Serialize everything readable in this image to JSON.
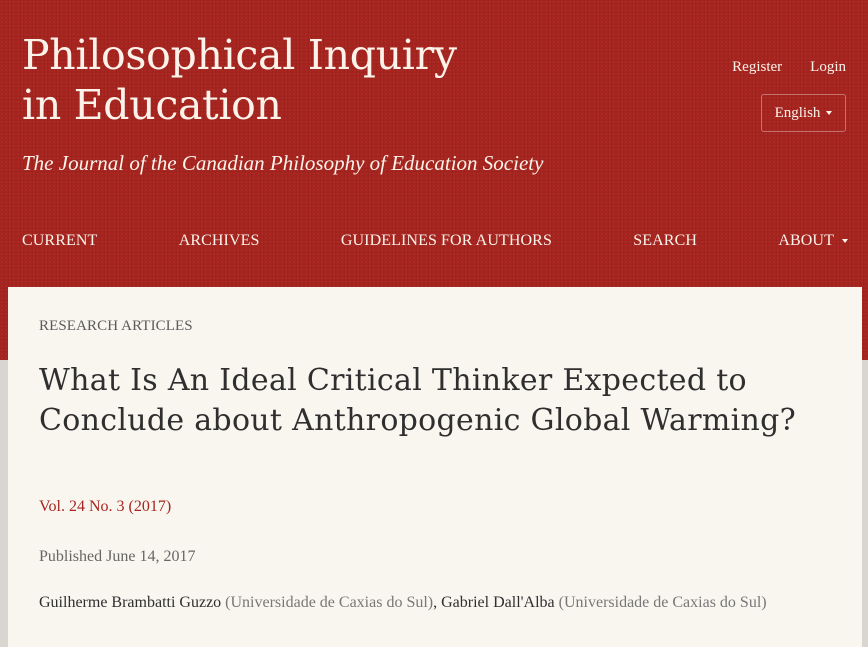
{
  "header": {
    "title_line1": "Philosophical Inquiry",
    "title_line2": "in Education",
    "tagline": "The Journal of the Canadian Philosophy of Education Society",
    "user_nav": {
      "register": "Register",
      "login": "Login"
    },
    "language": "English"
  },
  "nav": {
    "items": [
      {
        "label": "CURRENT"
      },
      {
        "label": "ARCHIVES"
      },
      {
        "label": "GUIDELINES FOR AUTHORS"
      },
      {
        "label": "SEARCH"
      },
      {
        "label": "ABOUT"
      }
    ]
  },
  "article": {
    "section": "RESEARCH ARTICLES",
    "title": "What Is An Ideal Critical Thinker Expected to Conclude about Anthropogenic Global Warming?",
    "issue": "Vol. 24 No. 3 (2017)",
    "published": "Published June 14, 2017",
    "authors": [
      {
        "name": "Guilherme Brambatti Guzzo",
        "affiliation": "(Universidade de Caxias do Sul)"
      },
      {
        "name": "Gabriel Dall'Alba",
        "affiliation": "(Universidade de Caxias do Sul)"
      }
    ],
    "author_separator": ","
  },
  "colors": {
    "brand_red": "#a7241f",
    "header_text": "#fbf3ea",
    "content_bg": "#f9f6f0"
  },
  "icons": {
    "language_dropdown": "chevron-down-icon",
    "about_dropdown": "chevron-down-icon"
  }
}
